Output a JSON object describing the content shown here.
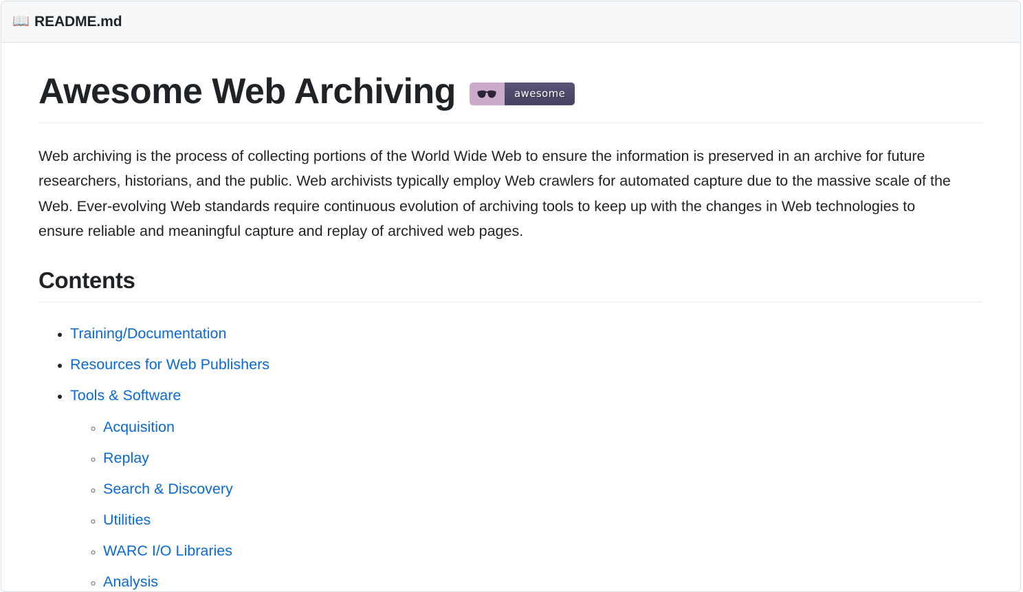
{
  "file_header": {
    "icon": "open-book-icon",
    "icon_glyph": "📖",
    "filename": "README.md"
  },
  "document": {
    "title": "Awesome Web Archiving",
    "badge": {
      "icon": "sunglasses-icon",
      "label": "awesome",
      "left_color": "#cbaacb",
      "right_color": "#494368"
    },
    "intro_paragraph": "Web archiving is the process of collecting portions of the World Wide Web to ensure the information is preserved in an archive for future researchers, historians, and the public. Web archivists typically employ Web crawlers for automated capture due to the massive scale of the Web. Ever-evolving Web standards require continuous evolution of archiving tools to keep up with the changes in Web technologies to ensure reliable and meaningful capture and replay of archived web pages.",
    "contents": {
      "heading": "Contents",
      "items": [
        {
          "label": "Training/Documentation",
          "children": []
        },
        {
          "label": "Resources for Web Publishers",
          "children": []
        },
        {
          "label": "Tools & Software",
          "children": [
            {
              "label": "Acquisition"
            },
            {
              "label": "Replay"
            },
            {
              "label": "Search & Discovery"
            },
            {
              "label": "Utilities"
            },
            {
              "label": "WARC I/O Libraries"
            },
            {
              "label": "Analysis"
            }
          ]
        }
      ]
    }
  },
  "colors": {
    "link": "#0969da",
    "text": "#1f2328",
    "header_bg": "#f6f8fa",
    "border": "#d8dee4",
    "rule": "#eaecef"
  }
}
